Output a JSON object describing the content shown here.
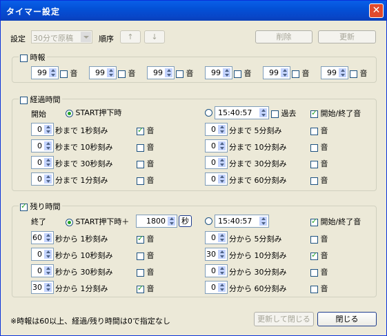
{
  "window": {
    "title": "タイマー設定",
    "close_glyph": "✕"
  },
  "toolbar": {
    "setting_label": "設定",
    "setting_value": "30分で原稿",
    "order_label": "順序",
    "up": "↑",
    "down": "↓",
    "delete": "削除",
    "update": "更新"
  },
  "jiho": {
    "title": "時報",
    "checked": false,
    "items": [
      {
        "value": "99",
        "label": "音"
      },
      {
        "value": "99",
        "label": "音"
      },
      {
        "value": "99",
        "label": "音"
      },
      {
        "value": "99",
        "label": "音"
      },
      {
        "value": "99",
        "label": "音"
      },
      {
        "value": "99",
        "label": "音"
      }
    ]
  },
  "elapsed": {
    "title": "経過時間",
    "checked": false,
    "start_label": "開始",
    "radio1": "START押下時",
    "time": "15:40:57",
    "past": "過去",
    "startend": "開始/終了音",
    "left": [
      {
        "value": "0",
        "text": "秒まで 1秒刻み",
        "sound": "音",
        "checked": true
      },
      {
        "value": "0",
        "text": "秒まで 10秒刻み",
        "sound": "音",
        "checked": false
      },
      {
        "value": "0",
        "text": "秒まで 30秒刻み",
        "sound": "音",
        "checked": false
      },
      {
        "value": "0",
        "text": "分まで 1分刻み",
        "sound": "音",
        "checked": false
      }
    ],
    "right": [
      {
        "value": "0",
        "text": "分まで 5分刻み",
        "sound": "音",
        "checked": false
      },
      {
        "value": "0",
        "text": "分まで 10分刻み",
        "sound": "音",
        "checked": false
      },
      {
        "value": "0",
        "text": "分まで 30分刻み",
        "sound": "音",
        "checked": false
      },
      {
        "value": "0",
        "text": "分まで 60分刻み",
        "sound": "音",
        "checked": false
      }
    ]
  },
  "remaining": {
    "title": "残り時間",
    "checked": true,
    "end_label": "終了",
    "radio1": "START押下時＋",
    "seconds": "1800",
    "sec_unit": "秒",
    "time": "15:40:57",
    "startend": "開始/終了音",
    "left": [
      {
        "value": "60",
        "text": "秒から 1秒刻み",
        "sound": "音",
        "checked": true
      },
      {
        "value": "0",
        "text": "秒から 10秒刻み",
        "sound": "音",
        "checked": false
      },
      {
        "value": "0",
        "text": "秒から 30秒刻み",
        "sound": "音",
        "checked": false
      },
      {
        "value": "30",
        "text": "分から 1分刻み",
        "sound": "音",
        "checked": true
      }
    ],
    "right": [
      {
        "value": "0",
        "text": "分から 5分刻み",
        "sound": "音",
        "checked": false
      },
      {
        "value": "30",
        "text": "分から 10分刻み",
        "sound": "音",
        "checked": true
      },
      {
        "value": "0",
        "text": "分から 30分刻み",
        "sound": "音",
        "checked": false
      },
      {
        "value": "0",
        "text": "分から 60分刻み",
        "sound": "音",
        "checked": false
      }
    ]
  },
  "footer": {
    "note": "※時報は60以上、経過/残り時間は0で指定なし",
    "update_close": "更新して閉じる",
    "close": "閉じる"
  }
}
